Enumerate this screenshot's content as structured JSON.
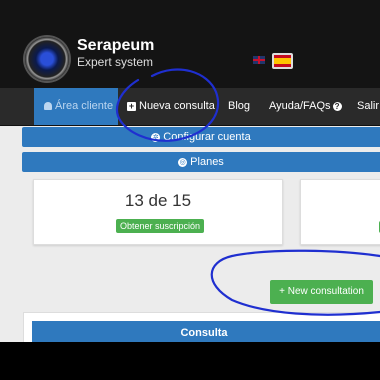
{
  "brand": {
    "title": "Serapeum",
    "subtitle": "Expert system"
  },
  "nav": {
    "items": [
      {
        "label": "Área cliente"
      },
      {
        "label": "Nueva consulta"
      },
      {
        "label": "Blog"
      },
      {
        "label": "Ayuda/FAQs"
      },
      {
        "label": "Salir"
      }
    ]
  },
  "account": {
    "config_label": "Configurar cuenta",
    "plans_label": "Planes"
  },
  "subscription": {
    "count": "13 de 15",
    "get_label": "Obtener suscripción"
  },
  "actions": {
    "new_consultation": "+ New consultation"
  },
  "consultations": {
    "header": "Consulta"
  },
  "colors": {
    "primary": "#2f79be",
    "success": "#4cb050",
    "header": "#141414",
    "nav": "#2a2a2a",
    "pen": "#1f2fd0"
  },
  "icons": [
    "user-icon",
    "plus-square-icon",
    "question-circle-icon",
    "gear-icon",
    "globe-icon",
    "plus-icon",
    "uk-flag-icon",
    "spain-flag-icon"
  ]
}
